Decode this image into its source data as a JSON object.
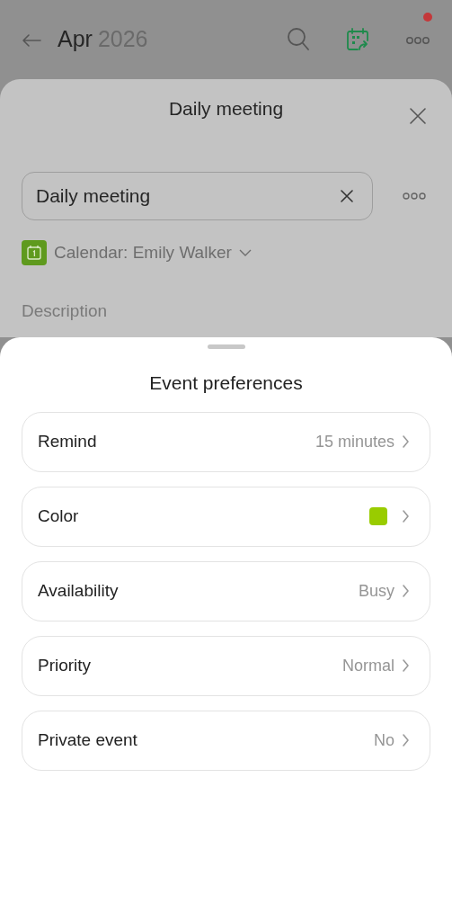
{
  "header": {
    "month": "Apr",
    "year": "2026",
    "notification": true
  },
  "event_sheet": {
    "title": "Daily meeting",
    "title_field": {
      "value": "Daily meeting"
    },
    "calendar": "Calendar: Emily Walker",
    "description_label": "Description"
  },
  "preferences": {
    "title": "Event preferences",
    "items": [
      {
        "kind": "value",
        "label": "Remind",
        "value": "15 minutes"
      },
      {
        "kind": "color",
        "label": "Color",
        "color": "#99cc00"
      },
      {
        "kind": "value",
        "label": "Availability",
        "value": "Busy"
      },
      {
        "kind": "value",
        "label": "Priority",
        "value": "Normal"
      },
      {
        "kind": "value",
        "label": "Private event",
        "value": "No"
      }
    ]
  }
}
